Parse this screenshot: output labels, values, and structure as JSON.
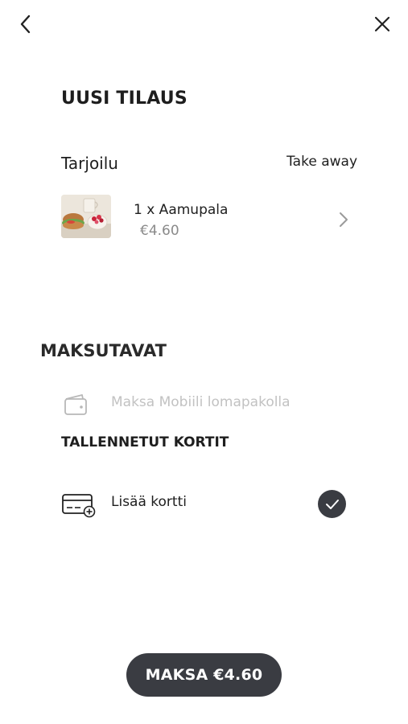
{
  "nav": {
    "back_icon": "chevron-left-icon",
    "close_icon": "close-icon"
  },
  "order": {
    "title": "UUSI TILAUS",
    "serving_label": "Tarjoilu",
    "serving_value": "Take away",
    "item": {
      "name": "1 x Aamupala",
      "price": "€4.60",
      "image": "breakfast-thumbnail"
    }
  },
  "payment": {
    "title": "MAKSUTAVAT",
    "wallet_option": "Maksa Mobiili lomapakolla",
    "saved_cards_title": "TALLENNETUT KORTIT",
    "add_card_label": "Lisää kortti",
    "add_card_selected": true
  },
  "footer": {
    "pay_button_label": "MAKSA €4.60"
  },
  "colors": {
    "dark": "#3a3c42",
    "muted": "#8a8a8a",
    "disabled": "#c2c2c2"
  }
}
